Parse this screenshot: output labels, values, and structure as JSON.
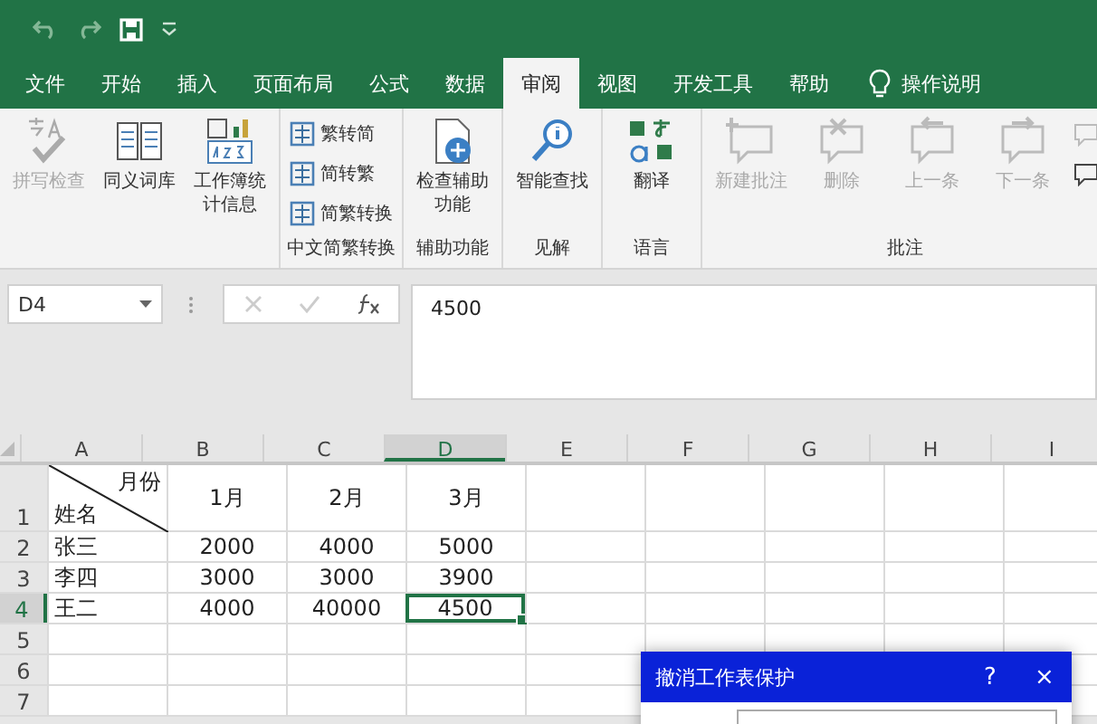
{
  "tabs": [
    {
      "label": "文件",
      "selected": false
    },
    {
      "label": "开始",
      "selected": false
    },
    {
      "label": "插入",
      "selected": false
    },
    {
      "label": "页面布局",
      "selected": false
    },
    {
      "label": "公式",
      "selected": false
    },
    {
      "label": "数据",
      "selected": false
    },
    {
      "label": "审阅",
      "selected": true
    },
    {
      "label": "视图",
      "selected": false
    },
    {
      "label": "开发工具",
      "selected": false
    },
    {
      "label": "帮助",
      "selected": false
    }
  ],
  "tell_me": "操作说明",
  "ribbon_groups": [
    {
      "items": [
        {
          "kind": "large",
          "label": "拼写检查",
          "disabled": true
        },
        {
          "kind": "large",
          "label": "同义词库",
          "disabled": false
        },
        {
          "kind": "large",
          "label": "工作簿统计信息",
          "disabled": false
        }
      ]
    },
    {
      "label": "中文简繁转换",
      "items": [
        {
          "kind": "small",
          "label": "繁转简",
          "disabled": false
        },
        {
          "kind": "small",
          "label": "简转繁",
          "disabled": false
        },
        {
          "kind": "small",
          "label": "简繁转换",
          "disabled": false
        }
      ]
    },
    {
      "label": "辅助功能",
      "items": [
        {
          "kind": "large",
          "label": "检查辅助功能",
          "disabled": false
        }
      ]
    },
    {
      "label": "见解",
      "items": [
        {
          "kind": "large",
          "label": "智能查找",
          "disabled": false
        }
      ]
    },
    {
      "label": "语言",
      "items": [
        {
          "kind": "large",
          "label": "翻译",
          "disabled": false
        }
      ]
    },
    {
      "label": "批注",
      "items": [
        {
          "kind": "large",
          "label": "新建批注",
          "disabled": true
        },
        {
          "kind": "large",
          "label": "删除",
          "disabled": true
        },
        {
          "kind": "large",
          "label": "上一条",
          "disabled": true
        },
        {
          "kind": "large",
          "label": "下一条",
          "disabled": true
        },
        {
          "kind": "small",
          "disabled": true
        },
        {
          "kind": "small",
          "disabled": false
        }
      ]
    }
  ],
  "name_box": "D4",
  "formula": "4500",
  "columns": [
    {
      "label": "A",
      "selected": false
    },
    {
      "label": "B",
      "selected": false
    },
    {
      "label": "C",
      "selected": false
    },
    {
      "label": "D",
      "selected": true
    },
    {
      "label": "E",
      "selected": false
    },
    {
      "label": "F",
      "selected": false
    },
    {
      "label": "G",
      "selected": false
    },
    {
      "label": "H",
      "selected": false
    },
    {
      "label": "I",
      "selected": false
    }
  ],
  "rows": [
    {
      "header": "1",
      "selected": false,
      "cells": [
        {
          "kind": "diagonal",
          "top": "月份",
          "bottom": "姓名"
        },
        {
          "text": "1月",
          "selected": false
        },
        {
          "text": "2月",
          "selected": false
        },
        {
          "text": "3月",
          "selected": false
        }
      ]
    },
    {
      "header": "2",
      "selected": false,
      "cells": [
        {
          "text": "张三",
          "selected": false
        },
        {
          "text": "2000",
          "selected": false
        },
        {
          "text": "4000",
          "selected": false
        },
        {
          "text": "5000",
          "selected": false
        }
      ]
    },
    {
      "header": "3",
      "selected": false,
      "cells": [
        {
          "text": "李四",
          "selected": false
        },
        {
          "text": "3000",
          "selected": false
        },
        {
          "text": "3000",
          "selected": false
        },
        {
          "text": "3900",
          "selected": false
        }
      ]
    },
    {
      "header": "4",
      "selected": true,
      "cells": [
        {
          "text": "王二",
          "selected": false
        },
        {
          "text": "4000",
          "selected": false
        },
        {
          "text": "40000",
          "selected": false
        },
        {
          "text": "4500",
          "selected": true
        }
      ]
    },
    {
      "header": "5",
      "selected": false,
      "cells": []
    },
    {
      "header": "6",
      "selected": false,
      "cells": []
    },
    {
      "header": "7",
      "selected": false,
      "cells": []
    }
  ],
  "dialog": {
    "title": "撤消工作表保护",
    "help": "?",
    "close": "×"
  }
}
